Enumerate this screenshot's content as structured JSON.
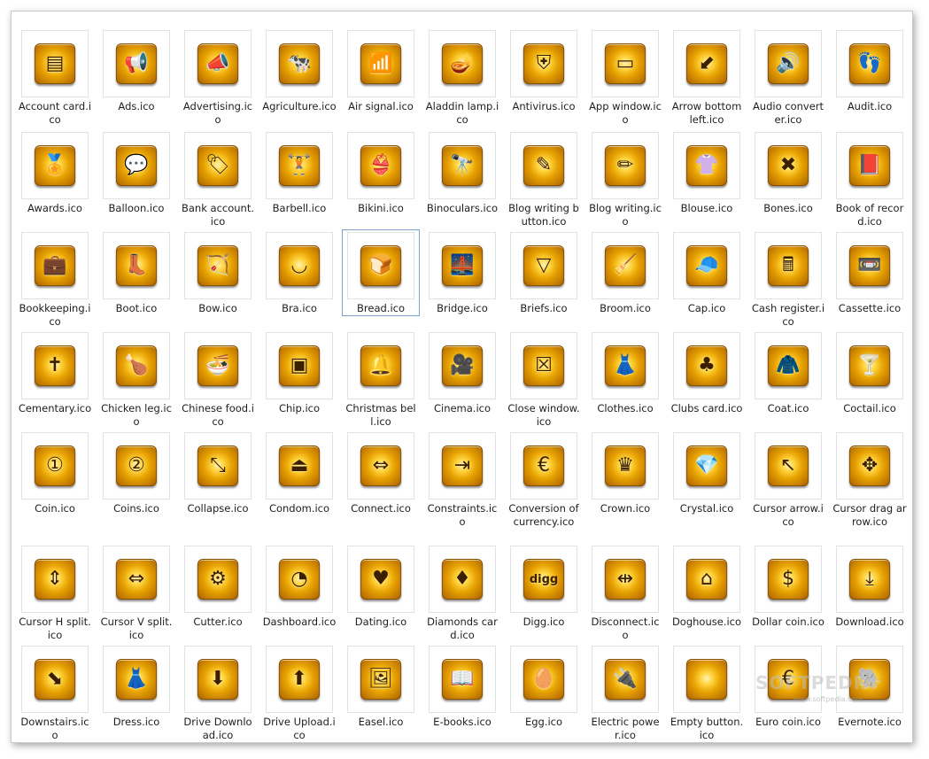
{
  "watermark": {
    "brand": "SOFTPEDIA",
    "url": "www.softpedia.com"
  },
  "rows": [
    [
      {
        "label": "Account card.ico",
        "icon": "id-card-icon",
        "glyph": "▤"
      },
      {
        "label": "Ads.ico",
        "icon": "megaphone-icon",
        "glyph": "📢"
      },
      {
        "label": "Advertising.ico",
        "icon": "bullhorn-icon",
        "glyph": "📣"
      },
      {
        "label": "Agriculture.ico",
        "icon": "cow-icon",
        "glyph": "🐄"
      },
      {
        "label": "Air signal.ico",
        "icon": "signal-bars-icon",
        "glyph": "📶"
      },
      {
        "label": "Aladdin lamp.ico",
        "icon": "magic-lamp-icon",
        "glyph": "🪔"
      },
      {
        "label": "Antivirus.ico",
        "icon": "shield-icon",
        "glyph": "⛨"
      },
      {
        "label": "App window.ico",
        "icon": "app-window-icon",
        "glyph": "▭"
      },
      {
        "label": "Arrow bottom left.ico",
        "icon": "arrow-bottom-left-icon",
        "glyph": "⬋"
      },
      {
        "label": "Audio converter.ico",
        "icon": "audio-converter-icon",
        "glyph": "🔊"
      },
      {
        "label": "Audit.ico",
        "icon": "footprint-search-icon",
        "glyph": "👣"
      }
    ],
    [
      {
        "label": "Awards.ico",
        "icon": "award-medals-icon",
        "glyph": "🏅"
      },
      {
        "label": "Balloon.ico",
        "icon": "speech-balloon-icon",
        "glyph": "💬"
      },
      {
        "label": "Bank account.ico",
        "icon": "dollar-tag-icon",
        "glyph": "🏷"
      },
      {
        "label": "Barbell.ico",
        "icon": "barbell-icon",
        "glyph": "🏋"
      },
      {
        "label": "Bikini.ico",
        "icon": "bikini-icon",
        "glyph": "👙"
      },
      {
        "label": "Binoculars.ico",
        "icon": "binoculars-icon",
        "glyph": "🔭"
      },
      {
        "label": "Blog writing button.ico",
        "icon": "blog-writing-button-icon",
        "glyph": "✎"
      },
      {
        "label": "Blog writing.ico",
        "icon": "blog-pencil-icon",
        "glyph": "✏"
      },
      {
        "label": "Blouse.ico",
        "icon": "blouse-icon",
        "glyph": "👚"
      },
      {
        "label": "Bones.ico",
        "icon": "crossed-bones-icon",
        "glyph": "✖"
      },
      {
        "label": "Book of record.ico",
        "icon": "record-book-icon",
        "glyph": "📕"
      }
    ],
    [
      {
        "label": "Bookkeeping.ico",
        "icon": "briefcase-dollar-icon",
        "glyph": "💼"
      },
      {
        "label": "Boot.ico",
        "icon": "boot-icon",
        "glyph": "👢"
      },
      {
        "label": "Bow.ico",
        "icon": "bow-arrow-icon",
        "glyph": "🏹"
      },
      {
        "label": "Bra.ico",
        "icon": "bra-icon",
        "glyph": "◡"
      },
      {
        "label": "Bread.ico",
        "icon": "bread-icon",
        "glyph": "🍞"
      },
      {
        "label": "Bridge.ico",
        "icon": "bridge-icon",
        "glyph": "🌉"
      },
      {
        "label": "Briefs.ico",
        "icon": "briefs-icon",
        "glyph": "▽"
      },
      {
        "label": "Broom.ico",
        "icon": "broom-icon",
        "glyph": "🧹"
      },
      {
        "label": "Cap.ico",
        "icon": "cap-icon",
        "glyph": "🧢"
      },
      {
        "label": "Cash register.ico",
        "icon": "cash-register-icon",
        "glyph": "🖩"
      },
      {
        "label": "Cassette.ico",
        "icon": "cassette-icon",
        "glyph": "📼"
      }
    ],
    [
      {
        "label": "Cementary.ico",
        "icon": "cemetery-crosses-icon",
        "glyph": "✝"
      },
      {
        "label": "Chicken leg.ico",
        "icon": "chicken-leg-icon",
        "glyph": "🍗"
      },
      {
        "label": "Chinese food.ico",
        "icon": "noodle-bowl-icon",
        "glyph": "🍜"
      },
      {
        "label": "Chip.ico",
        "icon": "microchip-icon",
        "glyph": "▣"
      },
      {
        "label": "Christmas bell.ico",
        "icon": "bell-icon",
        "glyph": "🔔"
      },
      {
        "label": "Cinema.ico",
        "icon": "movie-camera-icon",
        "glyph": "🎥"
      },
      {
        "label": "Close window.ico",
        "icon": "close-window-icon",
        "glyph": "☒"
      },
      {
        "label": "Clothes.ico",
        "icon": "clothes-icon",
        "glyph": "👗"
      },
      {
        "label": "Clubs card.ico",
        "icon": "clubs-card-icon",
        "glyph": "♣"
      },
      {
        "label": "Coat.ico",
        "icon": "coat-icon",
        "glyph": "🧥"
      },
      {
        "label": "Coctail.ico",
        "icon": "cocktail-icon",
        "glyph": "🍸"
      }
    ],
    [
      {
        "label": "Coin.ico",
        "icon": "coin-icon",
        "glyph": "①"
      },
      {
        "label": "Coins.ico",
        "icon": "coins-icon",
        "glyph": "②"
      },
      {
        "label": "Collapse.ico",
        "icon": "collapse-arrows-icon",
        "glyph": "⤡"
      },
      {
        "label": "Condom.ico",
        "icon": "condom-icon",
        "glyph": "⏏"
      },
      {
        "label": "Connect.ico",
        "icon": "connect-arrows-icon",
        "glyph": "⇔"
      },
      {
        "label": "Constraints.ico",
        "icon": "constraints-icon",
        "glyph": "⇥"
      },
      {
        "label": "Conversion of currency.ico",
        "icon": "currency-conversion-icon",
        "glyph": "€"
      },
      {
        "label": "Crown.ico",
        "icon": "crown-icon",
        "glyph": "♛"
      },
      {
        "label": "Crystal.ico",
        "icon": "diamond-crystal-icon",
        "glyph": "💎"
      },
      {
        "label": "Cursor arrow.ico",
        "icon": "cursor-arrow-icon",
        "glyph": "↖"
      },
      {
        "label": "Cursor drag arrow.ico",
        "icon": "drag-arrows-icon",
        "glyph": "✥"
      }
    ],
    [
      {
        "label": "Cursor H split.ico",
        "icon": "horizontal-split-icon",
        "glyph": "⇕"
      },
      {
        "label": "Cursor V split.ico",
        "icon": "vertical-split-icon",
        "glyph": "⇔"
      },
      {
        "label": "Cutter.ico",
        "icon": "saw-blade-icon",
        "glyph": "⚙"
      },
      {
        "label": "Dashboard.ico",
        "icon": "gauge-icon",
        "glyph": "◔"
      },
      {
        "label": "Dating.ico",
        "icon": "heart-icon",
        "glyph": "♥"
      },
      {
        "label": "Diamonds card.ico",
        "icon": "diamonds-card-icon",
        "glyph": "♦"
      },
      {
        "label": "Digg.ico",
        "icon": "digg-logo-icon",
        "glyph": "digg"
      },
      {
        "label": "Disconnect.ico",
        "icon": "disconnect-arrows-icon",
        "glyph": "⇹"
      },
      {
        "label": "Doghouse.ico",
        "icon": "doghouse-icon",
        "glyph": "⌂"
      },
      {
        "label": "Dollar coin.ico",
        "icon": "dollar-coin-icon",
        "glyph": "$"
      },
      {
        "label": "Download.ico",
        "icon": "download-tray-icon",
        "glyph": "⤓"
      }
    ],
    [
      {
        "label": "Downstairs.ico",
        "icon": "downstairs-icon",
        "glyph": "⬊"
      },
      {
        "label": "Dress.ico",
        "icon": "dress-icon",
        "glyph": "👗"
      },
      {
        "label": "Drive Download.ico",
        "icon": "drive-download-icon",
        "glyph": "⬇"
      },
      {
        "label": "Drive Upload.ico",
        "icon": "drive-upload-icon",
        "glyph": "⬆"
      },
      {
        "label": "Easel.ico",
        "icon": "easel-icon",
        "glyph": "🖼"
      },
      {
        "label": "E-books.ico",
        "icon": "ebook-reader-icon",
        "glyph": "📖"
      },
      {
        "label": "Egg.ico",
        "icon": "egg-icon",
        "glyph": "🥚"
      },
      {
        "label": "Electric power.ico",
        "icon": "battery-plug-icon",
        "glyph": "🔌"
      },
      {
        "label": "Empty button.ico",
        "icon": "empty-button-icon",
        "glyph": ""
      },
      {
        "label": "Euro coin.ico",
        "icon": "euro-coin-icon",
        "glyph": "€"
      },
      {
        "label": "Evernote.ico",
        "icon": "evernote-elephant-icon",
        "glyph": "🐘"
      }
    ]
  ]
}
